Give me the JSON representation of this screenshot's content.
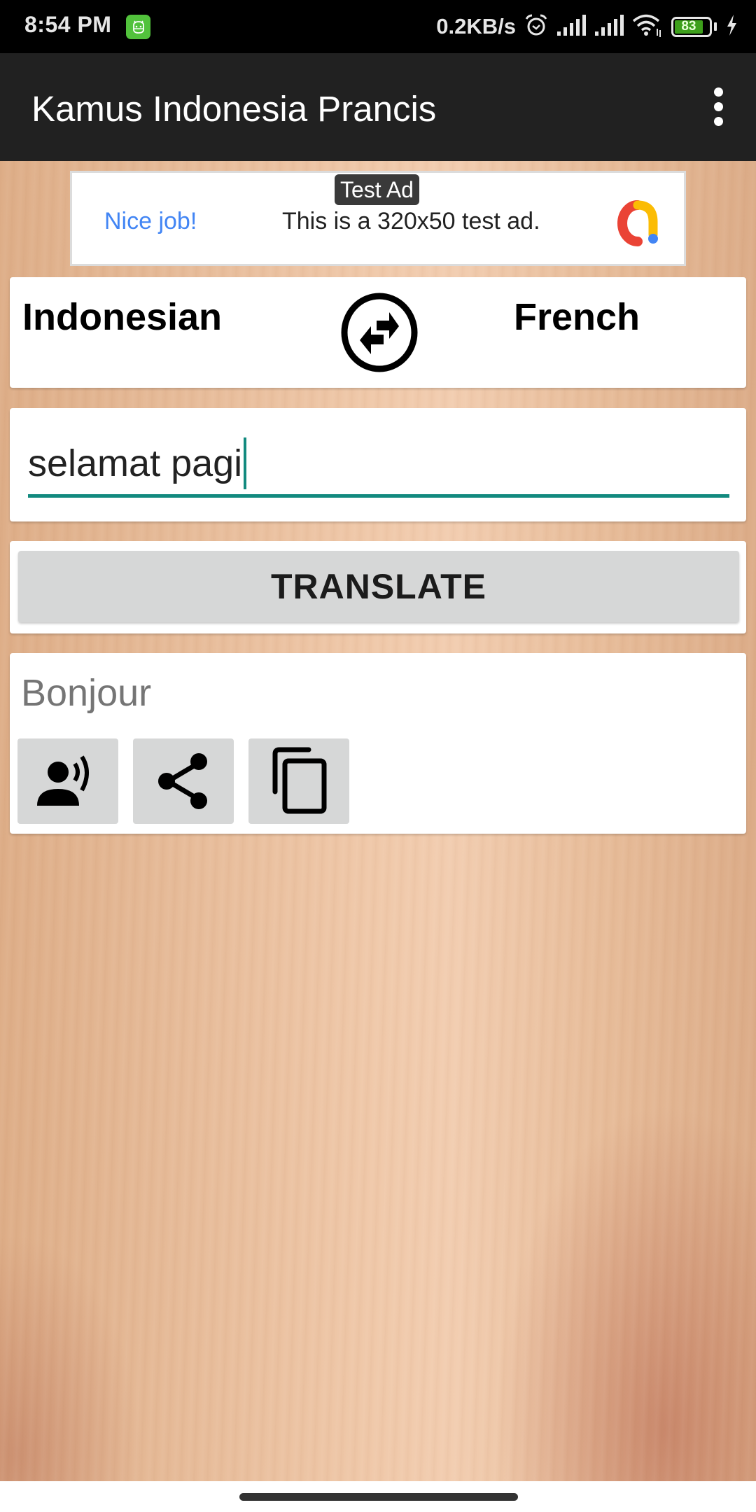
{
  "status_bar": {
    "time": "8:54 PM",
    "app_icon": "android-robot-icon",
    "net_speed": "0.2KB/s",
    "icons": [
      "alarm-icon",
      "signal-icon",
      "signal-icon",
      "wifi-icon",
      "battery-icon",
      "charging-icon"
    ],
    "battery_level": "83"
  },
  "app_bar": {
    "title": "Kamus Indonesia Prancis",
    "menu_icon": "more-vert-icon"
  },
  "ad": {
    "badge": "Test Ad",
    "headline": "Nice job!",
    "body": "This is a 320x50 test ad.",
    "colors": {
      "headline": "#4285f4"
    }
  },
  "languages": {
    "from": "Indonesian",
    "to": "French",
    "swap_icon": "swap-arrows-icon"
  },
  "input": {
    "value": "selamat pagi",
    "accent_color": "#128a7f"
  },
  "translate_button": {
    "label": "TRANSLATE"
  },
  "result": {
    "text": "Bonjour",
    "actions": [
      {
        "name": "speak",
        "icon": "record-voice-icon"
      },
      {
        "name": "share",
        "icon": "share-icon"
      },
      {
        "name": "copy",
        "icon": "copy-icon"
      }
    ]
  }
}
